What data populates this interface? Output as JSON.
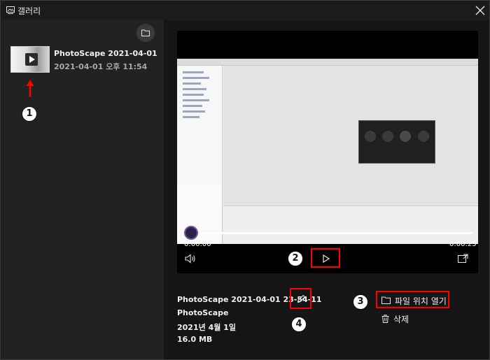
{
  "window": {
    "title": "갤러리",
    "icons": {
      "title": "gallery-icon",
      "close": "close-icon"
    }
  },
  "sidebar": {
    "folder_icon": "folder-icon",
    "items": [
      {
        "name": "PhotoScape 2021-04-01 23-...",
        "date": "2021-04-01 오후 11:54",
        "thumb_icon": "play-icon"
      }
    ]
  },
  "player": {
    "time_current": "0:00:00",
    "time_total": "0:00:25",
    "progress": 0,
    "icons": {
      "volume": "volume-icon",
      "play": "play-icon",
      "expand": "expand-icon"
    }
  },
  "details": {
    "name": "PhotoScape 2021-04-01 23-54-11",
    "app": "PhotoScape",
    "date": "2021년 4월 1일",
    "size": "16.0 MB",
    "icons": {
      "edit": "pencil-icon"
    }
  },
  "actions": {
    "open_location": "파일 위치 열기",
    "delete": "삭제",
    "icons": {
      "open_location": "folder-icon",
      "delete": "trash-icon"
    }
  },
  "annotations": {
    "markers": [
      "1",
      "2",
      "3",
      "4"
    ],
    "highlight_color": "#ff0000"
  }
}
